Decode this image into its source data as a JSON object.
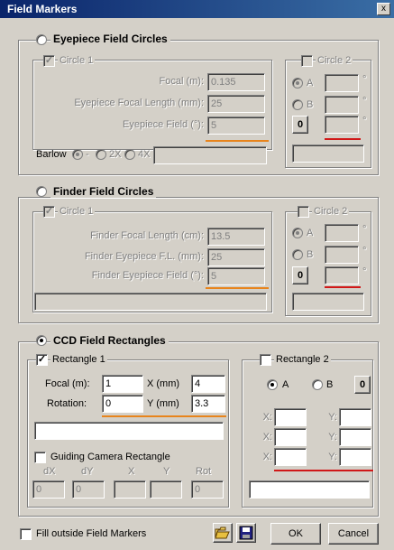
{
  "window": {
    "title": "Field Markers",
    "close": "x"
  },
  "eyepiece": {
    "title": "Eyepiece Field Circles",
    "circle1": {
      "label": "Circle 1",
      "focal_label": "Focal (m):",
      "focal_value": "0.135",
      "efl_label": "Eyepiece Focal Length (mm):",
      "efl_value": "25",
      "ef_label": "Eyepiece Field (°):",
      "ef_value": "5"
    },
    "barlow": {
      "label": "Barlow",
      "opt1": "-",
      "opt2": "2X",
      "opt3": "4X",
      "value": ""
    },
    "circle2": {
      "label": "Circle 2",
      "a": "A",
      "b": "B",
      "unit": "°",
      "zero": "0",
      "bottom_value": ""
    }
  },
  "finder": {
    "title": "Finder Field Circles",
    "circle1": {
      "label": "Circle 1",
      "ffl_label": "Finder Focal Length (cm):",
      "ffl_value": "13.5",
      "fefl_label": "Finder Eyepiece F.L. (mm):",
      "fefl_value": "25",
      "fef_label": "Finder Eyepiece Field (°):",
      "fef_value": "5",
      "bottom_value": ""
    },
    "circle2": {
      "label": "Circle 2",
      "a": "A",
      "b": "B",
      "unit": "°",
      "zero": "0",
      "bottom_value": ""
    }
  },
  "ccd": {
    "title": "CCD Field Rectangles",
    "rect1": {
      "label": "Rectangle 1",
      "focal_label": "Focal (m):",
      "focal_value": "1",
      "x_label": "X (mm)",
      "x_value": "4",
      "rotation_label": "Rotation:",
      "rotation_value": "0",
      "y_label": "Y (mm)",
      "y_value": "3.3",
      "info_value": ""
    },
    "guide": {
      "label": "Guiding Camera Rectangle",
      "cols": [
        "dX",
        "dY",
        "X",
        "Y",
        "Rot"
      ],
      "values": [
        "0",
        "0",
        "",
        "",
        "0"
      ]
    },
    "rect2": {
      "label": "Rectangle 2",
      "a": "A",
      "b": "B",
      "zero": "0",
      "labels": [
        "X:",
        "Y:",
        "X:",
        "Y:",
        "X:",
        "Y:"
      ],
      "bottom_value": ""
    }
  },
  "footer": {
    "fill_label": "Fill outside Field Markers",
    "ok": "OK",
    "cancel": "Cancel"
  },
  "colors": {
    "underline_orange": "#e8841c",
    "underline_red": "#d01818",
    "title_bar": "#0a246a"
  },
  "icons": [
    "folder-open-icon",
    "save-disk-icon"
  ]
}
